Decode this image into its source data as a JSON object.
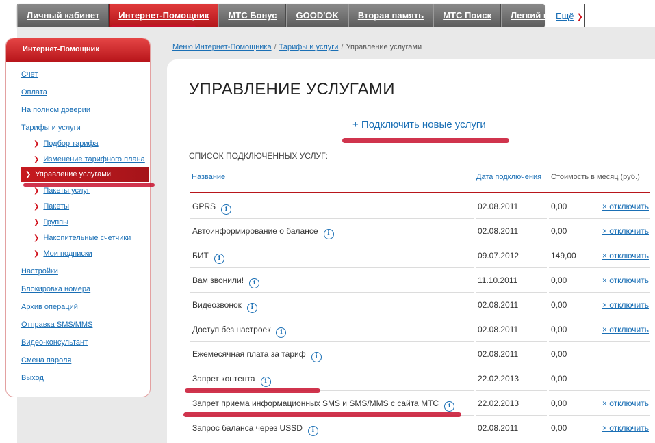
{
  "topnav": {
    "items": [
      {
        "label": "Личный кабинет",
        "active": false
      },
      {
        "label": "Интернет-Помощник",
        "active": true
      },
      {
        "label": "МТС Бонус",
        "active": false
      },
      {
        "label": "GOOD'OK",
        "active": false
      },
      {
        "label": "Вторая память",
        "active": false
      },
      {
        "label": "МТС Поиск",
        "active": false
      },
      {
        "label": "Легкий платеж",
        "active": false
      }
    ],
    "more_label": "Ещё"
  },
  "sidebar": {
    "title": "Интернет-Помощник",
    "items": [
      {
        "label": "Счет"
      },
      {
        "label": "Оплата"
      },
      {
        "label": "На полном доверии"
      },
      {
        "label": "Тарифы и услуги"
      },
      {
        "label": "Подбор тарифа",
        "sub": true
      },
      {
        "label": "Изменение тарифного плана",
        "sub": true
      },
      {
        "label": "Управление услугами",
        "sub": true,
        "active": true
      },
      {
        "label": "Пакеты услуг",
        "sub": true
      },
      {
        "label": "Пакеты",
        "sub": true
      },
      {
        "label": "Группы",
        "sub": true
      },
      {
        "label": "Накопительные счетчики",
        "sub": true
      },
      {
        "label": "Мои подписки",
        "sub": true
      },
      {
        "label": "Настройки"
      },
      {
        "label": "Блокировка номера"
      },
      {
        "label": "Архив операций"
      },
      {
        "label": "Отправка SMS/MMS"
      },
      {
        "label": "Видео-консультант"
      },
      {
        "label": "Смена пароля"
      },
      {
        "label": "Выход"
      }
    ]
  },
  "breadcrumb": {
    "items": [
      "Меню Интернет-Помощника",
      "Тарифы и услуги",
      "Управление услугами"
    ],
    "separator": "/"
  },
  "main": {
    "title": "УПРАВЛЕНИЕ УСЛУГАМИ",
    "add_link": "+ Подключить новые услуги",
    "list_caption": "СПИСОК ПОДКЛЮЧЕННЫХ УСЛУГ:",
    "columns": {
      "name": "Название",
      "date": "Дата подключения",
      "cost": "Стоимость в месяц (руб.)"
    },
    "rows": [
      {
        "name": "GPRS",
        "date": "02.08.2011",
        "cost": "0,00",
        "action": "× отключить"
      },
      {
        "name": "Автоинформирование о балансе",
        "date": "02.08.2011",
        "cost": "0,00",
        "action": "× отключить"
      },
      {
        "name": "БИТ",
        "date": "09.07.2012",
        "cost": "149,00",
        "action": "× отключить"
      },
      {
        "name": "Вам звонили!",
        "date": "11.10.2011",
        "cost": "0,00",
        "action": "× отключить"
      },
      {
        "name": "Видеозвонок",
        "date": "02.08.2011",
        "cost": "0,00",
        "action": "× отключить"
      },
      {
        "name": "Доступ без настроек",
        "date": "02.08.2011",
        "cost": "0,00",
        "action": "× отключить"
      },
      {
        "name": "Ежемесячная плата за тариф",
        "date": "02.08.2011",
        "cost": "0,00",
        "action": ""
      },
      {
        "name": "Запрет контента",
        "date": "22.02.2013",
        "cost": "0,00",
        "action": ""
      },
      {
        "name": "Запрет приема информационных SMS и SMS/MMS с сайта МТС",
        "date": "22.02.2013",
        "cost": "0,00",
        "action": "× отключить"
      },
      {
        "name": "Запрос баланса через USSD",
        "date": "02.08.2011",
        "cost": "0,00",
        "action": "× отключить"
      }
    ]
  },
  "icons": {
    "info": "info-icon",
    "more": "chevron-down-icon"
  },
  "colors": {
    "brand_red": "#c61a1f",
    "link_blue": "#1a6fb5",
    "annotation_red": "#c8102e"
  }
}
